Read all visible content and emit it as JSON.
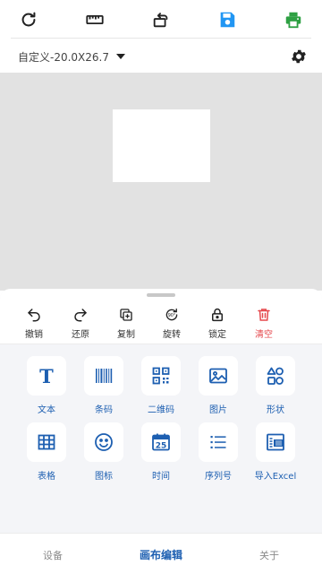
{
  "top_toolbar": {
    "icons": [
      "refresh-icon",
      "ruler-icon",
      "rotate-canvas-icon",
      "save-icon",
      "print-icon"
    ],
    "colors": {
      "save": "#2196f3",
      "print": "#2ea043"
    }
  },
  "label_size": {
    "value": "自定义-20.0X26.7"
  },
  "edit_tools": [
    {
      "label": "撤销",
      "icon": "undo-icon"
    },
    {
      "label": "还原",
      "icon": "redo-icon"
    },
    {
      "label": "复制",
      "icon": "copy-icon"
    },
    {
      "label": "旋转",
      "icon": "rotate-90-icon"
    },
    {
      "label": "锁定",
      "icon": "lock-icon"
    },
    {
      "label": "清空",
      "icon": "trash-icon"
    }
  ],
  "elements": [
    {
      "label": "文本",
      "icon": "text-icon"
    },
    {
      "label": "条码",
      "icon": "barcode-icon"
    },
    {
      "label": "二维码",
      "icon": "qrcode-icon"
    },
    {
      "label": "图片",
      "icon": "image-icon"
    },
    {
      "label": "形状",
      "icon": "shapes-icon"
    },
    {
      "label": "表格",
      "icon": "table-icon"
    },
    {
      "label": "图标",
      "icon": "smiley-icon"
    },
    {
      "label": "时间",
      "icon": "calendar-icon"
    },
    {
      "label": "序列号",
      "icon": "list-icon"
    },
    {
      "label": "导入Excel",
      "icon": "excel-icon"
    }
  ],
  "calendar_day": "25",
  "bottom_nav": [
    {
      "label": "设备",
      "active": false
    },
    {
      "label": "画布编辑",
      "active": true
    },
    {
      "label": "关于",
      "active": false
    }
  ],
  "colors": {
    "accent": "#1d5fb1",
    "danger": "#e5484d",
    "canvas_bg": "#e2e2e2",
    "sheet_bg": "#f4f5f8"
  }
}
